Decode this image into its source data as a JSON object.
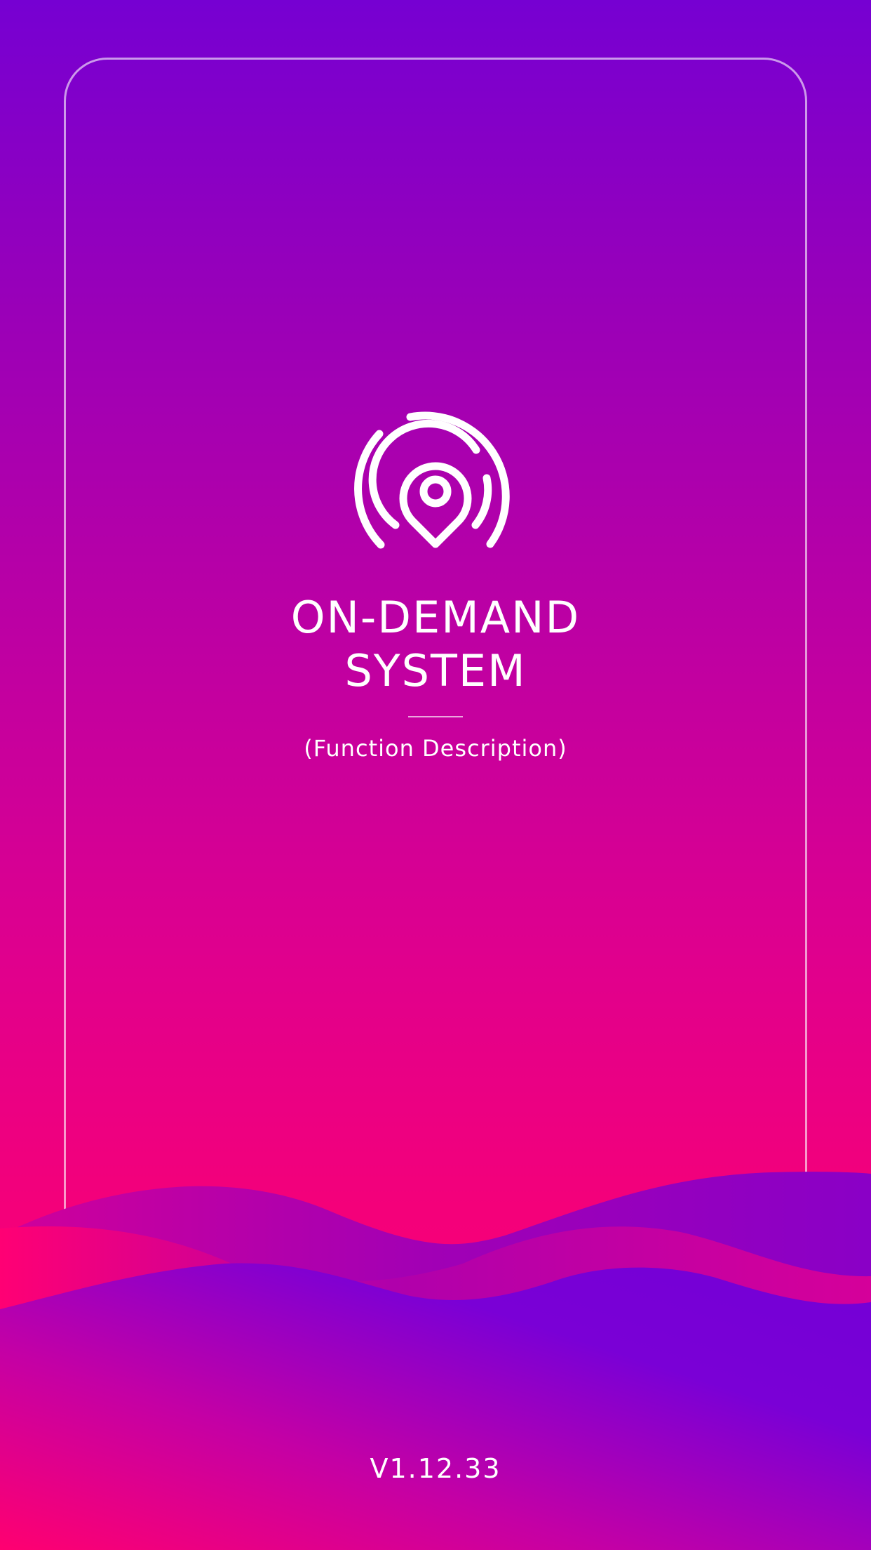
{
  "splash": {
    "title_line1": "ON-DEMAND",
    "title_line2": "SYSTEM",
    "subtitle": "(Function Description)",
    "version": "V1.12.33"
  },
  "icons": {
    "logo": "location-pin-signal-icon"
  },
  "colors": {
    "gradient_top": "#7600d2",
    "gradient_bottom": "#ff0070",
    "text": "#ffffff",
    "frame_border": "rgba(255,255,255,0.6)"
  }
}
